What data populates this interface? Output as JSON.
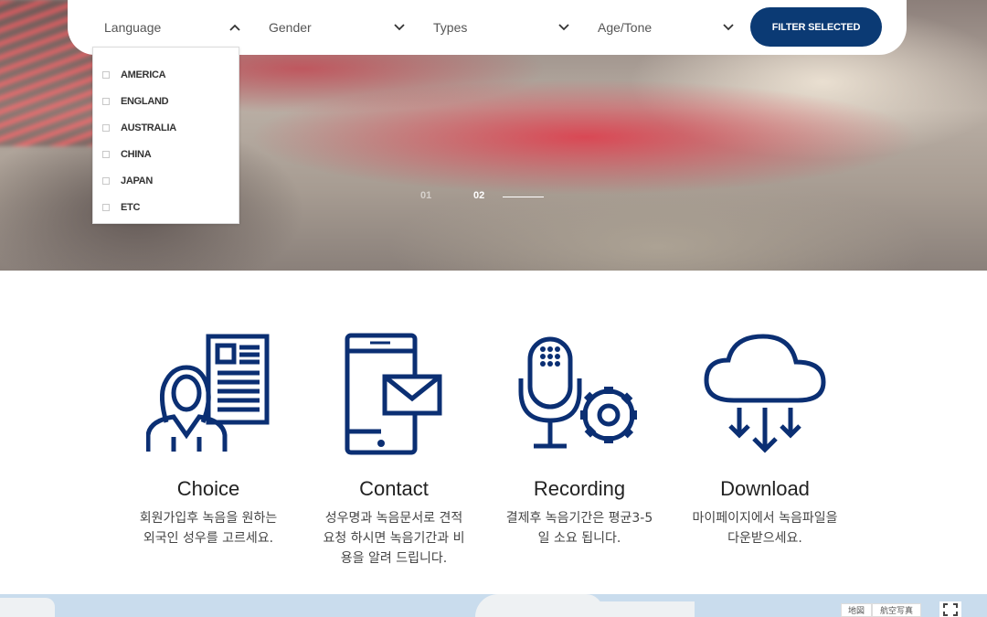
{
  "filters": {
    "language": {
      "label": "Language",
      "open": true
    },
    "gender": {
      "label": "Gender"
    },
    "types": {
      "label": "Types"
    },
    "age_tone": {
      "label": "Age/Tone"
    },
    "submit_label": "FILTER SELECTED"
  },
  "language_options": [
    "AMERICA",
    "ENGLAND",
    "AUSTRALIA",
    "CHINA",
    "JAPAN",
    "ETC"
  ],
  "slider": {
    "slide_1": "01",
    "slide_2": "02",
    "active": "02"
  },
  "steps": [
    {
      "title": "Choice",
      "desc_1": "회원가입후 녹음을 원하는",
      "desc_2": "외국인 성우를 고르세요.",
      "desc_3": "",
      "icon": "person-document-icon"
    },
    {
      "title": "Contact",
      "desc_1": "성우명과 녹음문서로 견적",
      "desc_2": "요청 하시면 녹음기간과 비",
      "desc_3": "용을 알려 드립니다.",
      "icon": "phone-mail-icon"
    },
    {
      "title": "Recording",
      "desc_1": "결제후 녹음기간은 평균3-5",
      "desc_2": "일 소요 됩니다.",
      "desc_3": "",
      "icon": "microphone-gear-icon"
    },
    {
      "title": "Download",
      "desc_1": "마이페이지에서 녹음파일을",
      "desc_2": "다운받으세요.",
      "desc_3": "",
      "icon": "cloud-download-icon"
    }
  ],
  "map": {
    "btn_map": "地図",
    "btn_satellite": "航空写真"
  },
  "colors": {
    "brand": "#0b3a74",
    "icon": "#0b2f73"
  }
}
